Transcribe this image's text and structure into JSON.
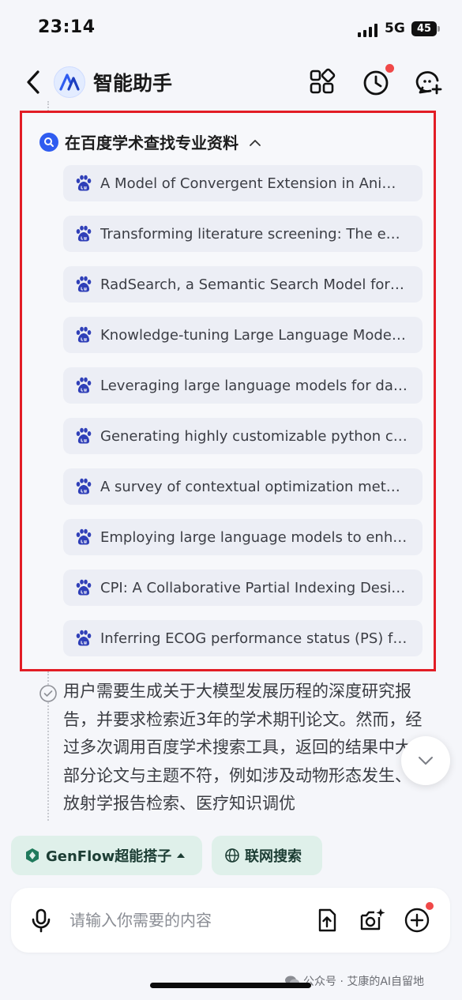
{
  "status": {
    "time": "23:14",
    "network": "5G",
    "battery": "45"
  },
  "header": {
    "title": "智能助手",
    "notification_dot": true
  },
  "search_panel": {
    "title": "在百度学术查找专业资料",
    "results": [
      "A Model of Convergent Extension in Animal Morphogenesis",
      "Transforming literature screening: The emerging role of large language models",
      "RadSearch, a Semantic Search Model for Accurate Radiology Report Retrieval",
      "Knowledge-tuning Large Language Models with Structured Medical Knowledge",
      "Leveraging large language models for data analysis",
      "Generating highly customizable python code",
      "A survey of contextual optimization methods",
      "Employing large language models to enhance",
      "CPI: A Collaborative Partial Indexing Design",
      "Inferring ECOG performance status (PS) from"
    ]
  },
  "reasoning": {
    "text": "用户需要生成关于大模型发展历程的深度研究报告，并要求检索近3年的学术期刊论文。然而，经过多次调用百度学术搜索工具，返回的结果中大部分论文与主题不符，例如涉及动物形态发生、放射学报告检索、医疗知识调优"
  },
  "chips": {
    "genflow": "GenFlow超能搭子",
    "web_search": "联网搜索"
  },
  "input": {
    "placeholder": "请输入你需要的内容"
  },
  "watermark": "公众号 · 艾康的AI自留地",
  "colors": {
    "accent": "#2f5cf0",
    "highlight_border": "#e21d25",
    "chip_bg": "#dff0ea",
    "notification": "#f04848"
  }
}
